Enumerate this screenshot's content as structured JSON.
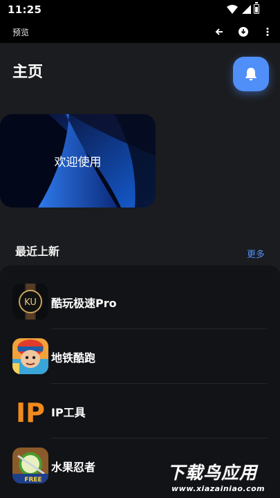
{
  "status_bar": {
    "time": "11:25"
  },
  "toolbar": {
    "title": "预览"
  },
  "header": {
    "title": "主页"
  },
  "banner": {
    "text": "欢迎使用"
  },
  "section": {
    "title": "最近上新",
    "more": "更多"
  },
  "apps": [
    {
      "name": "酷玩极速Pro",
      "icon": "ku-app-icon"
    },
    {
      "name": "地铁酷跑",
      "icon": "subway-surfers-icon"
    },
    {
      "name": "IP工具",
      "icon": "ip-tool-icon"
    },
    {
      "name": "水果忍者",
      "icon": "fruit-ninja-icon"
    }
  ],
  "icons": {
    "icon_ip_text": "IP",
    "icon_ku_text": "KU",
    "icon_free_text": "FREE"
  },
  "watermark": {
    "main": "下载鸟应用",
    "url": "www.xiazainiao.com"
  },
  "colors": {
    "accent": "#4f8ff7",
    "background": "#1b1c1f",
    "list_panel": "#121317"
  }
}
